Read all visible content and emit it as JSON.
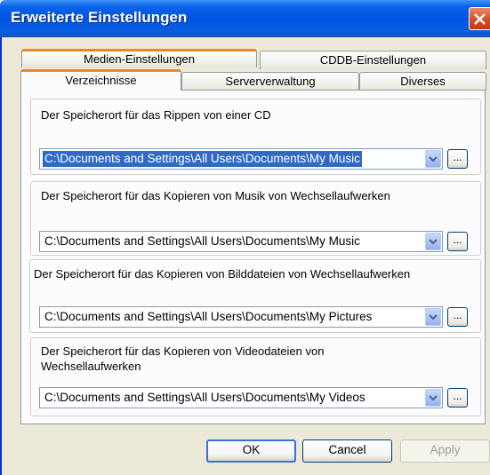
{
  "window": {
    "title": "Erweiterte Einstellungen",
    "close_icon": "close-icon"
  },
  "tabs": {
    "back_row": [
      {
        "label": "Medien-Einstellungen"
      },
      {
        "label": "CDDB-Einstellungen"
      }
    ],
    "front_row": [
      {
        "label": "Verzeichnisse",
        "active": true
      },
      {
        "label": "Serververwaltung"
      },
      {
        "label": "Diverses"
      }
    ]
  },
  "groups": [
    {
      "label": "Der Speicherort für das Rippen von einer CD",
      "path": "C:\\Documents and Settings\\All Users\\Documents\\My Music",
      "selected": true
    },
    {
      "label": "Der Speicherort für das Kopieren von Musik von Wechsellaufwerken",
      "path": "C:\\Documents and Settings\\All Users\\Documents\\My Music",
      "selected": false
    },
    {
      "label": "Der Speicherort für das Kopieren von Bilddateien von Wechsellaufwerken",
      "path": "C:\\Documents and Settings\\All Users\\Documents\\My Pictures",
      "selected": false
    },
    {
      "label": "Der Speicherort für das Kopieren von Videodateien von",
      "label_line2": "Wechsellaufwerken",
      "path": "C:\\Documents and Settings\\All Users\\Documents\\My Videos",
      "selected": false
    }
  ],
  "browse_label": "...",
  "buttons": {
    "ok": "OK",
    "cancel": "Cancel",
    "apply": "Apply"
  },
  "colors": {
    "titlebar": "#0054e3",
    "tab_highlight": "#e68b2c",
    "selection": "#316ac5"
  }
}
